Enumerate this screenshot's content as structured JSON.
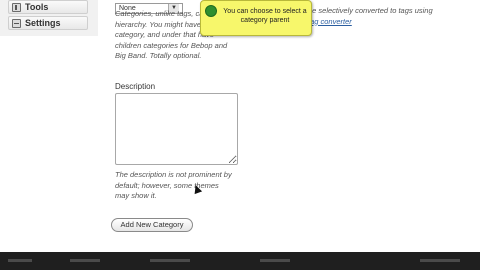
{
  "sidebar": {
    "items": [
      {
        "label": "Tools",
        "icon": "tools-icon"
      },
      {
        "label": "Settings",
        "icon": "settings-icon"
      }
    ]
  },
  "category_parent": {
    "selected": "None",
    "hint": "Categories, unlike tags, can have a hierarchy. You might have a Jazz category, and under that have children categories for Bebop and Big Band. Totally optional."
  },
  "tag_converter_hint": {
    "text": "be selectively converted to tags using",
    "link": "tag converter"
  },
  "tooltip": {
    "text": "You can choose to select a category parent"
  },
  "description": {
    "label": "Description",
    "value": "",
    "hint": "The description is not prominent by default; however, some themes may show it."
  },
  "actions": {
    "add_new_category_label": "Add New Category"
  },
  "colors": {
    "tooltip_bg": "#f7f76b",
    "link": "#2b5ea0",
    "bottom_bar": "#1f1f1f"
  }
}
